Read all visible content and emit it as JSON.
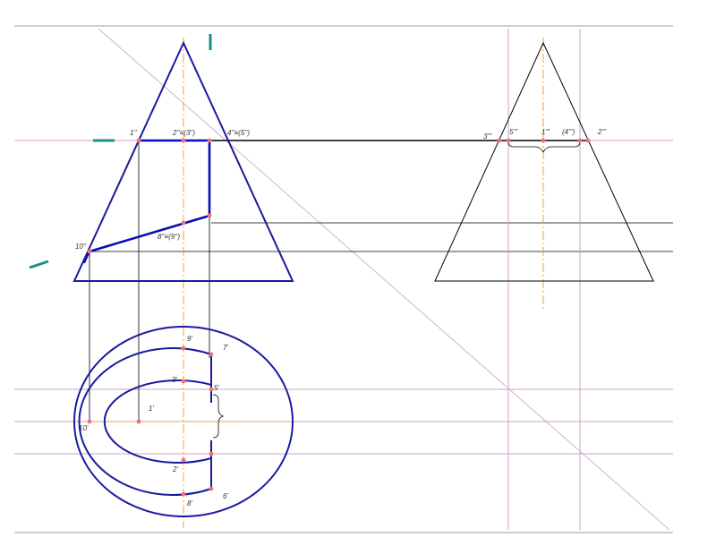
{
  "colors": {
    "background": "#ffffff",
    "frame": "#d8d8d8",
    "construction_line": "#000000",
    "contour": "#1a1aa0",
    "section_cut": "#0b0bb5",
    "axis": "#f0a030",
    "horizontal_trace": "#d0a0c8",
    "diagonal": "#c8b8d0",
    "point": "#f07080",
    "marker": "#1a9080"
  },
  "labels": {
    "front": {
      "p1": "1''",
      "p2_3": "2''≡(3'')",
      "p4_5": "4''≡(5'')",
      "p8_9": "8''≡(9'')",
      "p10": "10''"
    },
    "side": {
      "p3": "3'''",
      "p5": "5'''",
      "p1": "1'''",
      "p4": "(4''')",
      "p2": "2'''"
    },
    "top": {
      "p9": "9'",
      "p7": "7'",
      "p3": "3'",
      "p5": "5'",
      "p1": "1'",
      "p10": "10'",
      "p2": "2'",
      "p8": "8'",
      "p6": "6'"
    }
  }
}
